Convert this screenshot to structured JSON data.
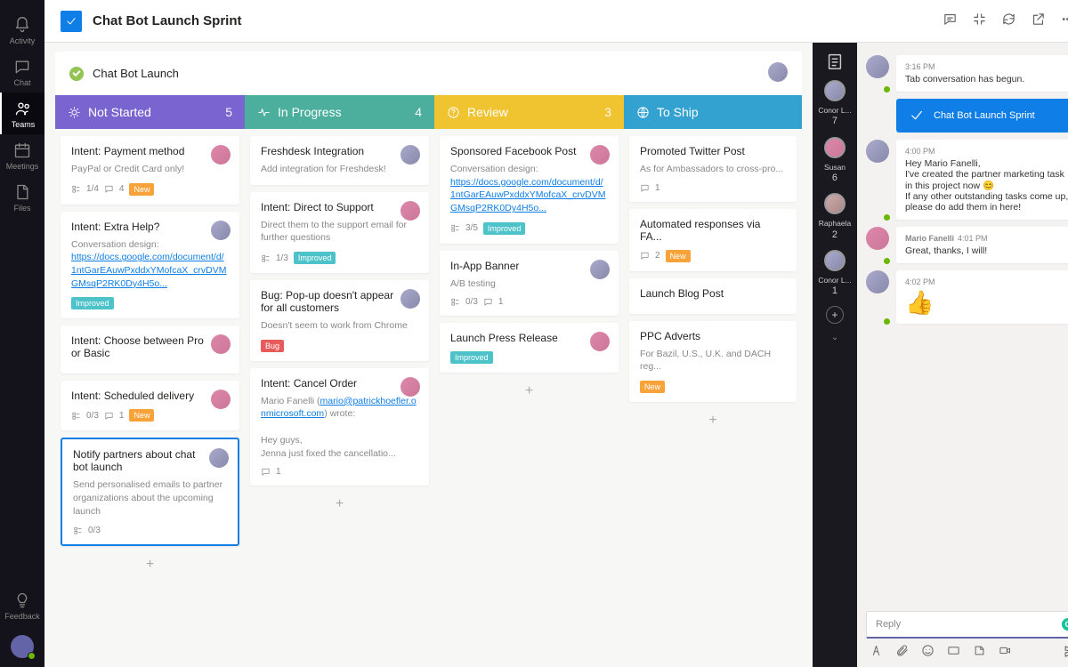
{
  "rail": {
    "items": [
      {
        "label": "Activity"
      },
      {
        "label": "Chat"
      },
      {
        "label": "Teams"
      },
      {
        "label": "Meetings"
      },
      {
        "label": "Files"
      }
    ],
    "feedback": "Feedback"
  },
  "topbar": {
    "title": "Chat Bot Launch Sprint"
  },
  "project": {
    "name": "Chat Bot Launch"
  },
  "columns": [
    {
      "title": "Not Started",
      "count": "5",
      "color": "c1"
    },
    {
      "title": "In Progress",
      "count": "4",
      "color": "c2"
    },
    {
      "title": "Review",
      "count": "3",
      "color": "c3"
    },
    {
      "title": "To Ship",
      "count": "",
      "color": "c4"
    }
  ],
  "cards": {
    "notStarted": [
      {
        "title": "Intent: Payment method",
        "desc": "PayPal or Credit Card only!",
        "checks": "1/4",
        "comments": "4",
        "tag": "New"
      },
      {
        "title": "Intent: Extra Help?",
        "desc_label": "Conversation design:",
        "link": "https://docs.google.com/document/d/1ntGarEAuwPxddxYMofcaX_crvDVMGMsqP2RK0Dy4H5o...",
        "tag": "Improved"
      },
      {
        "title": "Intent: Choose between Pro or Basic"
      },
      {
        "title": "Intent: Scheduled delivery",
        "checks": "0/3",
        "comments": "1",
        "tag": "New"
      },
      {
        "title": "Notify partners about chat bot launch",
        "desc": "Send personalised emails to partner organizations about the upcoming launch",
        "checks": "0/3",
        "selected": true
      }
    ],
    "inProgress": [
      {
        "title": "Freshdesk Integration",
        "desc": "Add integration for Freshdesk!"
      },
      {
        "title": "Intent: Direct to Support",
        "desc": "Direct them to the support email for further questions",
        "checks": "1/3",
        "tag": "Improved"
      },
      {
        "title": "Bug: Pop-up doesn't appear for all customers",
        "desc": "Doesn't seem to work from Chrome",
        "tag": "Bug"
      },
      {
        "title": "Intent: Cancel Order",
        "author": "Mario Fanelli (",
        "email": "mario@patrickhoefler.onmicrosoft.com",
        "author2": ") wrote:",
        "body1": "Hey guys,",
        "body2": "Jenna just fixed the cancellatio...",
        "comments": "1"
      }
    ],
    "review": [
      {
        "title": "Sponsored Facebook Post",
        "desc_label": "Conversation design:",
        "link": "https://docs.google.com/document/d/1ntGarEAuwPxddxYMofcaX_crvDVMGMsqP2RK0Dy4H5o...",
        "checks": "3/5",
        "tag": "Improved"
      },
      {
        "title": "In-App Banner",
        "desc": "A/B testing",
        "checks": "0/3",
        "comments": "1"
      },
      {
        "title": "Launch Press Release",
        "tag": "Improved"
      }
    ],
    "toShip": [
      {
        "title": "Promoted Twitter Post",
        "desc": "As for Ambassadors to cross-pro...",
        "comments": "1"
      },
      {
        "title": "Automated responses via FA...",
        "comments": "2",
        "tag": "New"
      },
      {
        "title": "Launch Blog Post"
      },
      {
        "title": "PPC Adverts",
        "desc": "For Bazil, U.S., U.K. and DACH reg...",
        "tag": "New"
      }
    ]
  },
  "people": [
    {
      "name": "Conor L...",
      "badge": "7"
    },
    {
      "name": "Susan",
      "badge": "6"
    },
    {
      "name": "Raphaela",
      "badge": "2"
    },
    {
      "name": "Conor L...",
      "badge": "1"
    }
  ],
  "chat": {
    "m1": {
      "ts": "3:16 PM",
      "text": "Tab conversation has begun."
    },
    "pill": "Chat Bot Launch Sprint",
    "m2": {
      "ts": "4:00 PM",
      "l1": "Hey Mario Fanelli,",
      "l2": "I've created the partner marketing task in this project now 😊",
      "l3": "If any other outstanding tasks come up, please do add them in here!"
    },
    "m3": {
      "name": "Mario Fanelli",
      "ts": "4:01 PM",
      "text": "Great, thanks, I will!"
    },
    "m4": {
      "ts": "4:02 PM",
      "emoji": "👍"
    },
    "reply_placeholder": "Reply"
  }
}
